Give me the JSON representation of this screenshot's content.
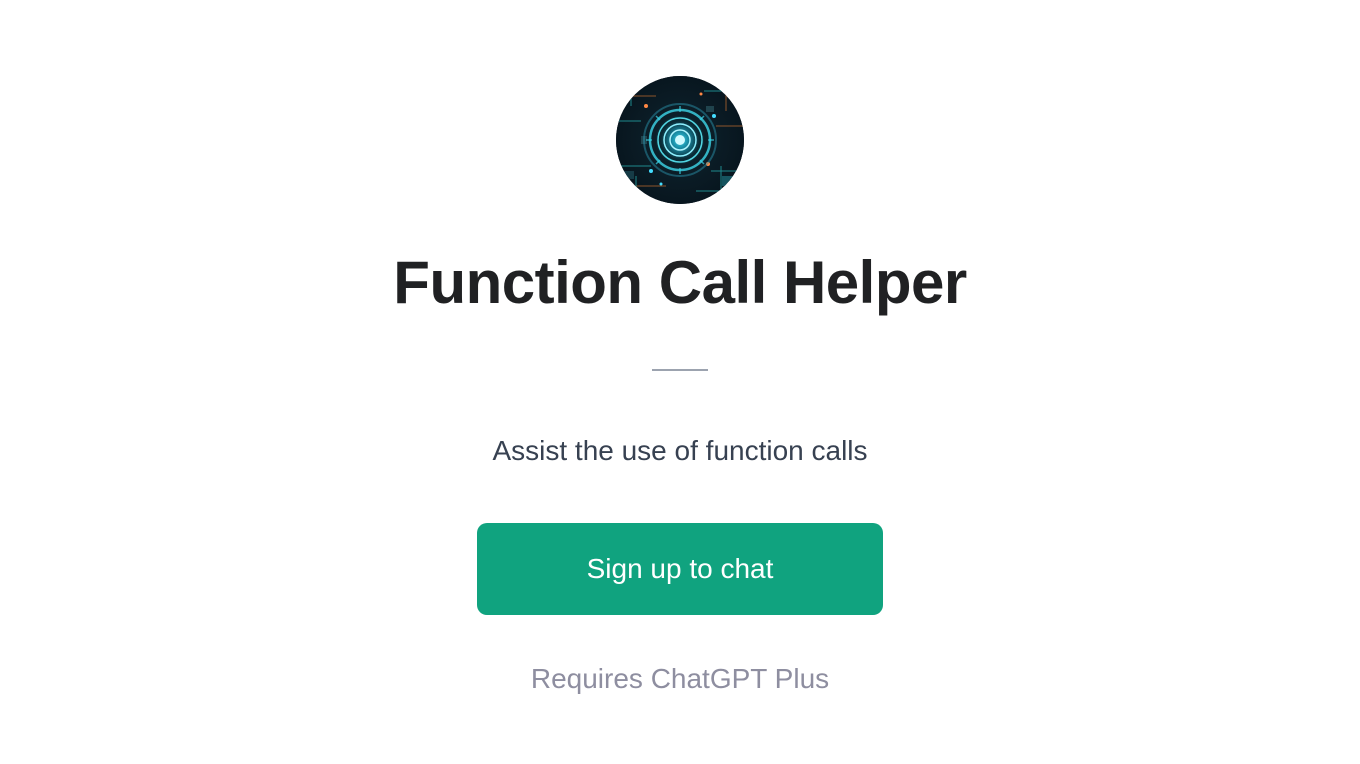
{
  "hero": {
    "title": "Function Call Helper",
    "description": "Assist the use of function calls",
    "cta_label": "Sign up to chat",
    "requirement": "Requires ChatGPT Plus"
  }
}
